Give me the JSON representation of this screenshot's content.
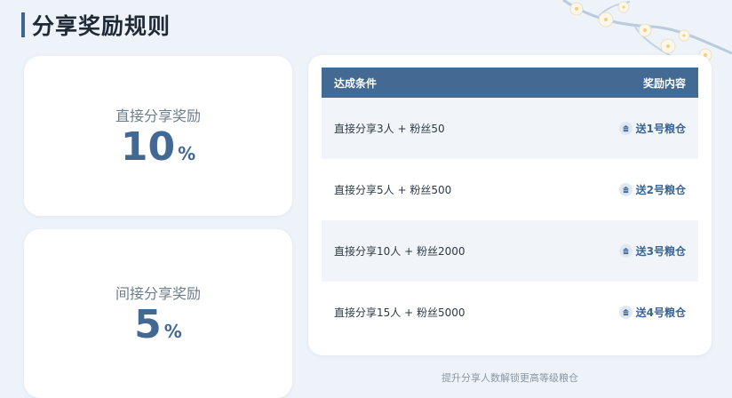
{
  "header": {
    "title": "分享奖励规则"
  },
  "direct_card": {
    "label": "直接分享奖励",
    "value": "10",
    "unit": "%"
  },
  "indirect_card": {
    "label": "间接分享奖励",
    "value": "5",
    "unit": "%"
  },
  "table": {
    "col_condition": "达成条件",
    "col_reward": "奖励内容",
    "rows": [
      {
        "condition": "直接分享3人 + 粉丝50",
        "reward": "送1号粮仓",
        "icon": "granary-icon"
      },
      {
        "condition": "直接分享5人 + 粉丝500",
        "reward": "送2号粮仓",
        "icon": "granary-icon"
      },
      {
        "condition": "直接分享10人 + 粉丝2000",
        "reward": "送3号粮仓",
        "icon": "granary-icon"
      },
      {
        "condition": "直接分享15人 + 粉丝5000",
        "reward": "送4号粮仓",
        "icon": "granary-icon"
      }
    ]
  },
  "footer_note": "提升分享人数解锁更高等级粮仓",
  "colors": {
    "accent": "#436a93",
    "background": "#eef3f9",
    "row_alt": "#f1f5fa"
  }
}
